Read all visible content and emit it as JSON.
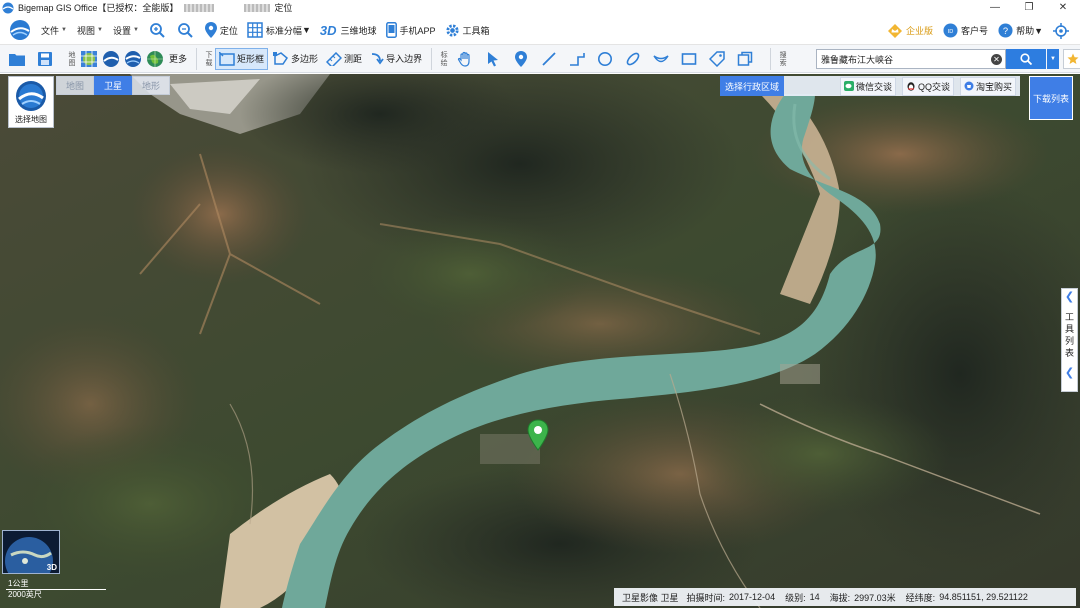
{
  "window": {
    "title": "Bigemap GIS Office【已授权：全能版】",
    "authorized_suffix": "定位",
    "controls": {
      "minimize": "—",
      "maximize": "❐",
      "close": "✕"
    }
  },
  "menubar": {
    "file": "文件",
    "view": "视图",
    "settings": "设置",
    "locate": "定位",
    "std_division": "标准分幅",
    "three_d_label": "3D",
    "three_d_globe": "三维地球",
    "mobile_app": "手机APP",
    "toolbox": "工具箱",
    "enterprise": "企业版",
    "account": "客户号",
    "help": "帮助"
  },
  "toolbar": {
    "group_map": "地图",
    "more": "更多",
    "group_download": "下载",
    "rect": "矩形框",
    "polygon": "多边形",
    "measure": "测距",
    "import_boundary": "导入边界",
    "group_mark": "标绘",
    "group_search": "搜索",
    "search_value": "雅鲁藏布江大峡谷"
  },
  "map": {
    "switch_label": "选择地图",
    "tabs": [
      {
        "label": "地图",
        "active": false
      },
      {
        "label": "卫星",
        "active": true
      },
      {
        "label": "地形",
        "active": false
      }
    ],
    "region_label": "选择行政区域",
    "wechat": "微信交谈",
    "qq": "QQ交谈",
    "taobao": "淘宝购买",
    "download_list": "下载列表",
    "tool_list": "工具列表",
    "overview_3d": "3D",
    "scale_top": "1公里",
    "scale_bottom": "2000英尺"
  },
  "status": {
    "layer": "卫星影像 卫星",
    "capture_label": "拍摄时间:",
    "capture_date": "2017-12-04",
    "level_label": "级别:",
    "level": "14",
    "altitude_label": "海拔:",
    "altitude": "2997.03米",
    "coords_label": "经纬度:",
    "coords": "94.851151, 29.521122"
  },
  "colors": {
    "accent": "#3f7ee6",
    "search_btn": "#2d7de0",
    "river": "#6fa89a",
    "pin": "#3cb44b"
  }
}
